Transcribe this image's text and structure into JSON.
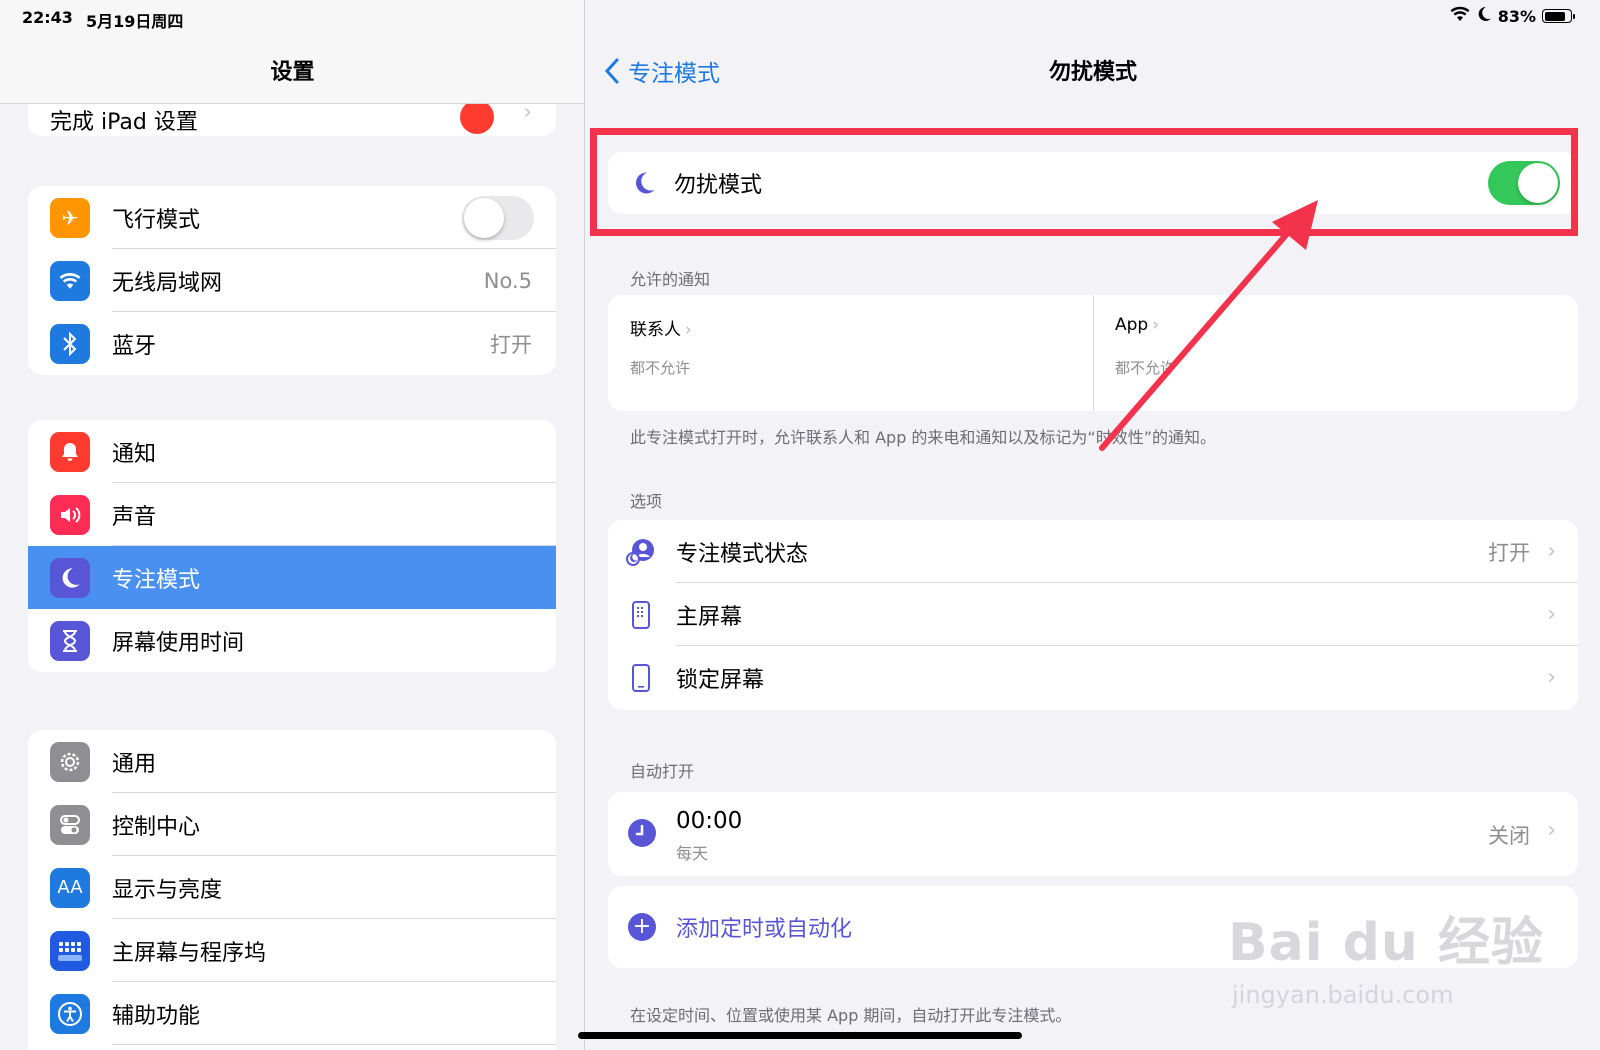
{
  "status_bar": {
    "time": "22:43",
    "date": "5月19日周四",
    "battery": "83%",
    "battery_level": 0.83
  },
  "sidebar": {
    "title": "设置",
    "partial_row_label": "完成 iPad 设置",
    "group1": [
      {
        "label": "飞行模式",
        "value": "",
        "icon": "airplane-icon",
        "color": "#ff9500"
      },
      {
        "label": "无线局域网",
        "value": "No.5",
        "icon": "wifi-icon",
        "color": "#1f7ae0"
      },
      {
        "label": "蓝牙",
        "value": "打开",
        "icon": "bluetooth-icon",
        "color": "#1f7ae0"
      }
    ],
    "group2": [
      {
        "label": "通知",
        "icon": "bell-icon",
        "color": "#ff3b30"
      },
      {
        "label": "声音",
        "icon": "speaker-icon",
        "color": "#ff2d55"
      },
      {
        "label": "专注模式",
        "icon": "moon-icon",
        "color": "#5856d6",
        "selected": true
      },
      {
        "label": "屏幕使用时间",
        "icon": "hourglass-icon",
        "color": "#5856d6"
      }
    ],
    "group3": [
      {
        "label": "通用",
        "icon": "gear-icon",
        "color": "#8e8e93"
      },
      {
        "label": "控制中心",
        "icon": "switches-icon",
        "color": "#8e8e93"
      },
      {
        "label": "显示与亮度",
        "icon": "text-size-icon",
        "color": "#1f7ae0"
      },
      {
        "label": "主屏幕与程序坞",
        "icon": "home-grid-icon",
        "color": "#1f5ae0"
      },
      {
        "label": "辅助功能",
        "icon": "accessibility-icon",
        "color": "#1f7ae0"
      }
    ],
    "glyphs": {
      "aa": "AA"
    }
  },
  "main": {
    "back_label": "专注模式",
    "title": "勿扰模式",
    "dnd_label": "勿扰模式",
    "dnd_on": true,
    "allowed_header": "允许的通知",
    "contacts_title": "联系人",
    "contacts_sub": "都不允许",
    "apps_title": "App",
    "apps_sub": "都不允许",
    "allowed_note": "此专注模式打开时，允许联系人和 App 的来电和通知以及标记为“时效性”的通知。",
    "options_header": "选项",
    "options": [
      {
        "label": "专注模式状态",
        "value": "打开",
        "icon": "focus-status-icon"
      },
      {
        "label": "主屏幕",
        "value": "",
        "icon": "home-screen-icon"
      },
      {
        "label": "锁定屏幕",
        "value": "",
        "icon": "lock-screen-icon"
      }
    ],
    "auto_header": "自动打开",
    "schedule_time": "00:00",
    "schedule_days": "每天",
    "schedule_status": "关闭",
    "add_label": "添加定时或自动化",
    "auto_note": "在设定时间、位置或使用某 App 期间，自动打开此专注模式。"
  },
  "watermark": {
    "line1": "Bai du 经验",
    "line2": "jingyan.baidu.com"
  },
  "colors": {
    "accent": "#1f7ae0",
    "focus_purple": "#5856d6",
    "toggle_on": "#34c759",
    "annotation_red": "#f2334b",
    "selected_row": "#4a90f0"
  }
}
